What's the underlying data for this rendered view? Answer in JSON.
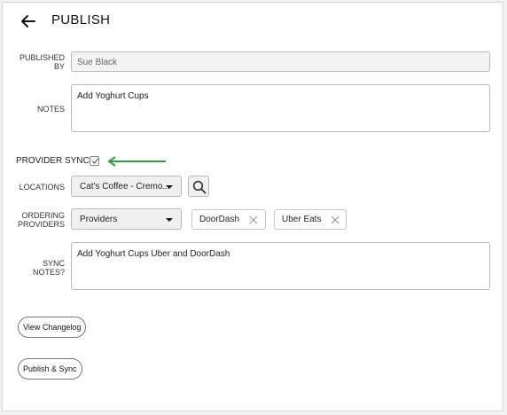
{
  "header": {
    "back_icon": "arrow-left-icon",
    "title": "PUBLISH"
  },
  "published_by": {
    "label_line1": "PUBLISHED",
    "label_line2": "BY",
    "value": "Sue Black"
  },
  "notes": {
    "label": "NOTES",
    "value": "Add Yoghurt Cups"
  },
  "provider_sync": {
    "label": "PROVIDER SYNC",
    "checked": true,
    "arrow_color": "#2e9e3e"
  },
  "locations": {
    "label": "LOCATIONS",
    "selected": "Cat's Coffee - Cremo...",
    "search_icon": "search-icon"
  },
  "ordering_providers": {
    "label_line1": "ORDERING",
    "label_line2": "PROVIDERS",
    "selected": "Providers",
    "chips": [
      {
        "label": "DoorDash"
      },
      {
        "label": "Uber Eats"
      }
    ]
  },
  "sync_notes": {
    "label_line1": "SYNC",
    "label_line2": "NOTES?",
    "value": "Add Yoghurt Cups Uber and DoorDash"
  },
  "buttons": {
    "changelog": "View Changelog",
    "publish_sync": "Publish & Sync"
  }
}
